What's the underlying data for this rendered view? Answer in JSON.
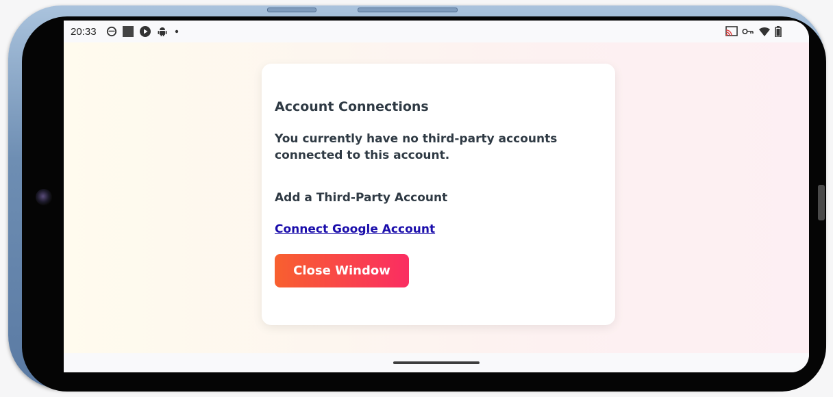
{
  "status_bar": {
    "time": "20:33",
    "left_icons": [
      "timer-icon",
      "stop-square-icon",
      "play-circle-icon",
      "android-icon",
      "dot-icon"
    ],
    "right_icons": [
      "cast-icon",
      "vpn-key-icon",
      "wifi-icon",
      "battery-icon"
    ]
  },
  "card": {
    "title": "Account Connections",
    "description": "You currently have no third-party accounts connected to this account.",
    "subtitle": "Add a Third-Party Account",
    "connect_link": "Connect Google Account",
    "close_button": "Close Window"
  },
  "colors": {
    "button_gradient_start": "#f8602f",
    "button_gradient_end": "#fa2d62",
    "link": "#1a0dab",
    "text": "#2f3a44"
  }
}
